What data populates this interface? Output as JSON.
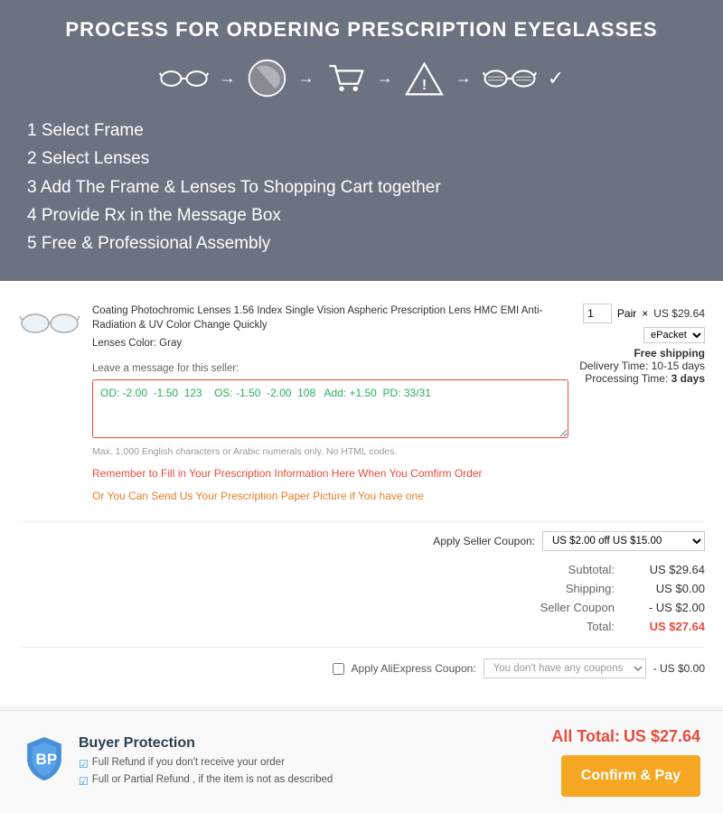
{
  "banner": {
    "title": "PROCESS FOR ORDERING PRESCRIPTION EYEGLASSES",
    "steps": [
      "1 Select Frame",
      "2 Select Lenses",
      "3 Add The Frame & Lenses To Shopping Cart together",
      "4 Provide Rx in the Message Box",
      "5 Free & Professional Assembly"
    ]
  },
  "product": {
    "name": "Coating Photochromic Lenses 1.56 Index Single Vision Aspheric Prescription Lens HMC EMI Anti-Radiation & UV Color Change Quickly",
    "color_label": "Lenses Color:",
    "color_value": "Gray",
    "qty": "1",
    "unit": "Pair",
    "price": "US $29.64",
    "shipping_method": "ePacket",
    "free_shipping": "Free shipping",
    "delivery_label": "Delivery Time:",
    "delivery_value": "10-15 days",
    "processing_label": "Processing Time:",
    "processing_value": "3 days"
  },
  "message": {
    "label": "Leave a message for this seller:",
    "content": "OD: -2.00  -1.50  123    OS: -1.50  -2.00  108   Add: +1.50  PD: 33/31",
    "max_chars": "Max. 1,000 English characters or Arabic numerals only. No HTML codes."
  },
  "reminders": {
    "red": "Remember to Fill in Your Prescription Information Here When You Comfirm Order",
    "orange": "Or You Can Send Us Your Prescription Paper Picture if You have one"
  },
  "coupon": {
    "label": "Apply Seller Coupon:",
    "value": "US $2.00 off US $15.00"
  },
  "summary": {
    "subtotal_label": "Subtotal:",
    "subtotal_value": "US $29.64",
    "shipping_label": "Shipping:",
    "shipping_value": "US $0.00",
    "seller_coupon_label": "Seller Coupon",
    "seller_coupon_value": "- US $2.00",
    "total_label": "Total:",
    "total_value": "US $27.64"
  },
  "ali_coupon": {
    "checkbox_label": "Apply AliExpress Coupon:",
    "placeholder": "You don't have any coupons",
    "discount": "- US $0.00"
  },
  "footer": {
    "buyer_protection_title": "Buyer Protection",
    "protection_item1": "Full Refund if you don't receive your order",
    "protection_item2": "Full or Partial Refund , if the item is not as described",
    "all_total_label": "All Total:",
    "all_total_value": "US $27.64",
    "confirm_button": "Confirm & Pay"
  }
}
